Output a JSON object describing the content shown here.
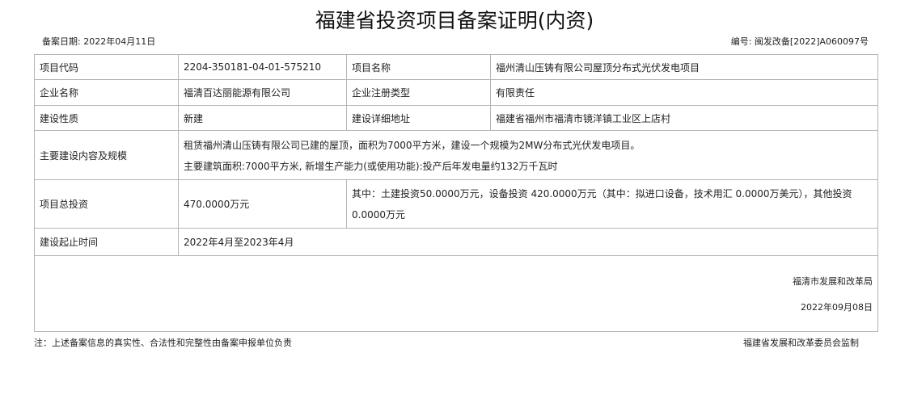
{
  "title": "福建省投资项目备案证明(内资)",
  "record_date": "备案日期:  2022年04月11日",
  "record_no": "编号:  闽发改备[2022]A060097号",
  "rows": {
    "project_code": {
      "label": "项目代码",
      "value": "2204-350181-04-01-575210"
    },
    "project_name": {
      "label": "项目名称",
      "value": "福州清山压铸有限公司屋顶分布式光伏发电项目"
    },
    "company_name": {
      "label": "企业名称",
      "value": "福清百达丽能源有限公司"
    },
    "company_type": {
      "label": "企业注册类型",
      "value": "有限责任"
    },
    "build_nature": {
      "label": "建设性质",
      "value": "新建"
    },
    "address": {
      "label": "建设详细地址",
      "value": "福建省福州市福清市镜洋镇工业区上店村"
    },
    "content": {
      "label": "主要建设内容及规模",
      "line1": "租赁福州清山压铸有限公司已建的屋顶，面积为7000平方米，建设一个规模为2MW分布式光伏发电项目。",
      "line2": "主要建筑面积:7000平方米, 新增生产能力(或使用功能):投产后年发电量约132万千瓦时"
    },
    "investment": {
      "label": "项目总投资",
      "value": "470.0000万元",
      "detail": "其中：土建投资50.0000万元，设备投资 420.0000万元（其中：拟进口设备，技术用汇 0.0000万美元），其他投资0.0000万元"
    },
    "period": {
      "label": "建设起止时间",
      "value": "2022年4月至2023年4月"
    }
  },
  "signature": {
    "org": "福清市发展和改革局",
    "date": "2022年09月08日"
  },
  "footer": {
    "note": "注：上述备案信息的真实性、合法性和完整性由备案申报单位负责",
    "supervisor": "福建省发展和改革委员会监制"
  }
}
